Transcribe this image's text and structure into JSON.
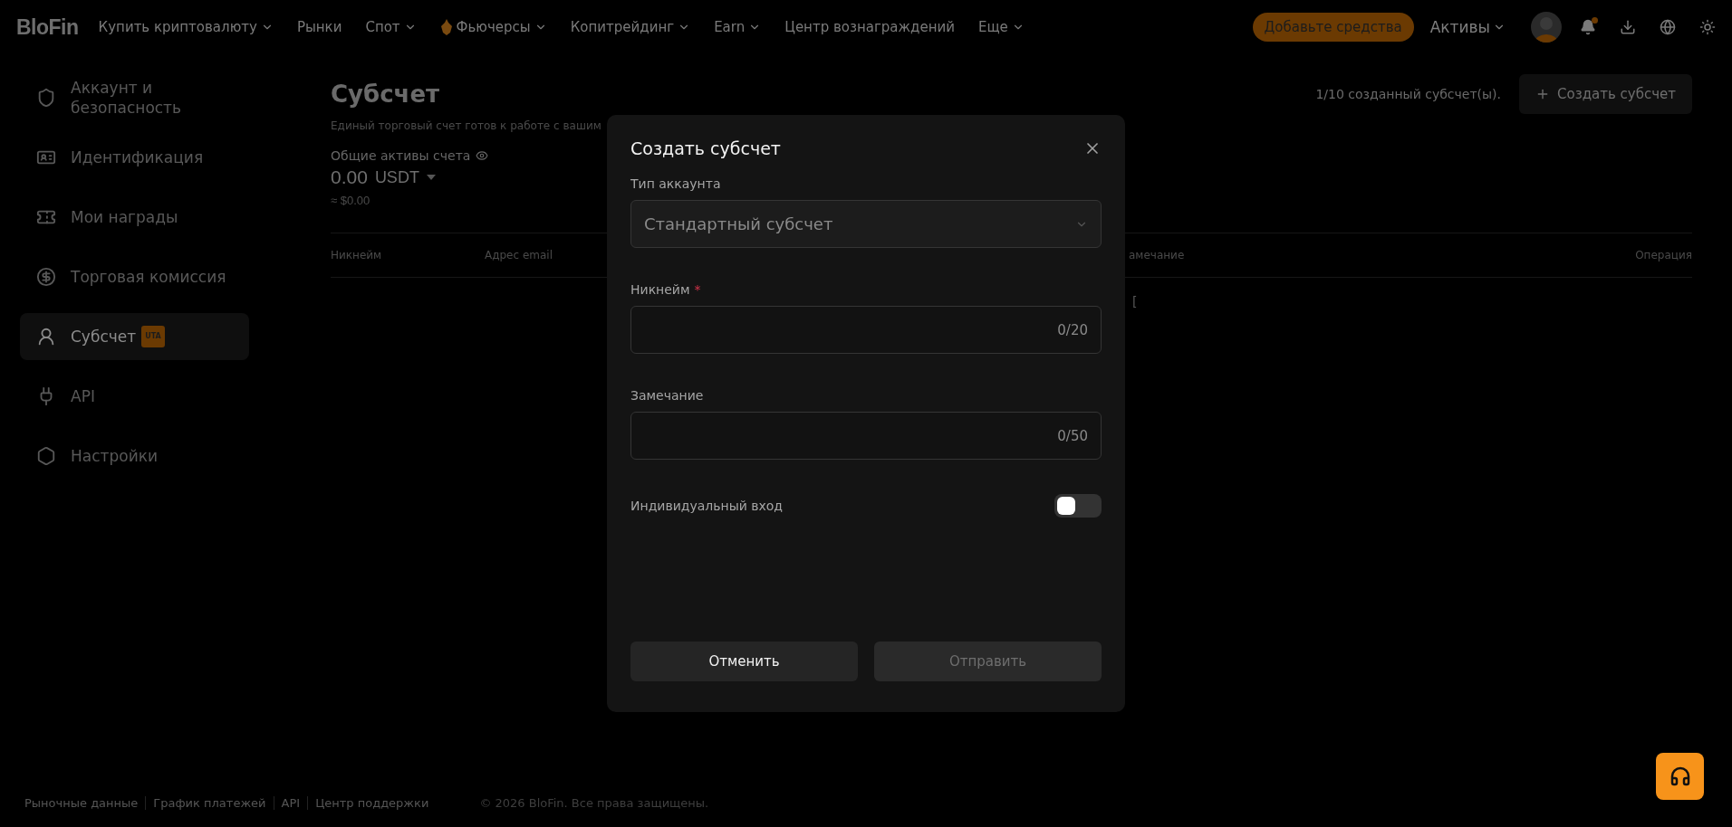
{
  "header": {
    "logo": "BloFin",
    "nav": [
      {
        "label": "Купить криптовалюту",
        "dropdown": true,
        "featured": false
      },
      {
        "label": "Рынки",
        "dropdown": false,
        "featured": false
      },
      {
        "label": "Спот",
        "dropdown": true,
        "featured": false
      },
      {
        "label": "Фьючерсы",
        "dropdown": true,
        "featured": true
      },
      {
        "label": "Копитрейдинг",
        "dropdown": true,
        "featured": false
      },
      {
        "label": "Earn",
        "dropdown": true,
        "featured": false
      },
      {
        "label": "Центр вознаграждений",
        "dropdown": false,
        "featured": false
      },
      {
        "label": "Еще",
        "dropdown": true,
        "featured": false
      }
    ],
    "deposit_button": "Добавьте средства",
    "assets_menu": "Активы"
  },
  "sidebar": {
    "items": [
      {
        "label": "Аккаунт и безопасность",
        "selected": false
      },
      {
        "label": "Идентификация",
        "selected": false
      },
      {
        "label": "Мои награды",
        "selected": false
      },
      {
        "label": "Торговая комиссия",
        "selected": false
      },
      {
        "label": "Субсчет",
        "selected": true,
        "badge": "UTA"
      },
      {
        "label": "API",
        "selected": false
      },
      {
        "label": "Настройки",
        "selected": false
      }
    ]
  },
  "content": {
    "title": "Субсчет",
    "subtitle": "Единый торговый счет готов к работе с вашим",
    "assets_label": "Общие активы счета",
    "balance": "0.00",
    "currency": "USDT",
    "approx": "≈ $0.00",
    "count": "1/10 созданный субсчет(ы).",
    "create_button": "Создать субсчет",
    "table": {
      "columns": [
        "Никнейм",
        "Адрес email",
        "амечание",
        "Операция"
      ],
      "empty_fragment": "["
    }
  },
  "modal": {
    "title": "Создать субсчет",
    "fields": [
      {
        "kind": "select",
        "label": "Тип аккаунта",
        "value": "Стандартный субсчет"
      },
      {
        "kind": "input",
        "label": "Никнейм",
        "marker": "*",
        "counter": "0/20"
      },
      {
        "kind": "input",
        "label": "Замечание",
        "counter": "0/50"
      }
    ],
    "toggle": {
      "label": "Индивидуальный вход",
      "on": false
    },
    "buttons": [
      {
        "label": "Отменить",
        "disabled": false
      },
      {
        "label": "Отправить",
        "disabled": true
      }
    ]
  },
  "footer": {
    "links": [
      "Рыночные данные",
      "График платежей",
      "API",
      "Центр поддержки"
    ],
    "copyright": "© 2026 BloFin. Все права защищены."
  }
}
